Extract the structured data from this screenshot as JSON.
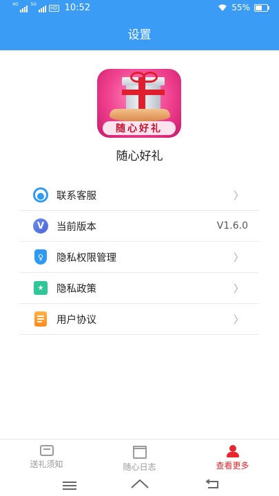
{
  "statusbar": {
    "net1": "4G",
    "net2": "5G",
    "hd": "HD",
    "time": "10:52",
    "battery_text": "55%",
    "battery_level": 0.55
  },
  "header": {
    "title": "设置"
  },
  "app": {
    "logo_text": "随心好礼",
    "name": "随心好礼"
  },
  "menu": {
    "items": [
      {
        "label": "联系客服",
        "icon": "customer-service-icon",
        "value": ""
      },
      {
        "label": "当前版本",
        "icon": "version-icon",
        "value": "V1.6.0"
      },
      {
        "label": "隐私权限管理",
        "icon": "privacy-shield-icon",
        "value": ""
      },
      {
        "label": "隐私政策",
        "icon": "policy-star-icon",
        "value": ""
      },
      {
        "label": "用户协议",
        "icon": "agreement-document-icon",
        "value": ""
      }
    ]
  },
  "tabbar": {
    "tabs": [
      {
        "label": "送礼须知",
        "icon": "home-icon",
        "active": false
      },
      {
        "label": "随心日志",
        "icon": "gift-box-icon",
        "active": false
      },
      {
        "label": "查看更多",
        "icon": "user-icon",
        "active": true
      }
    ]
  },
  "colors": {
    "primary": "#3a9cf5",
    "active_tab": "#e8262e",
    "text": "#222222",
    "muted": "#999999"
  }
}
